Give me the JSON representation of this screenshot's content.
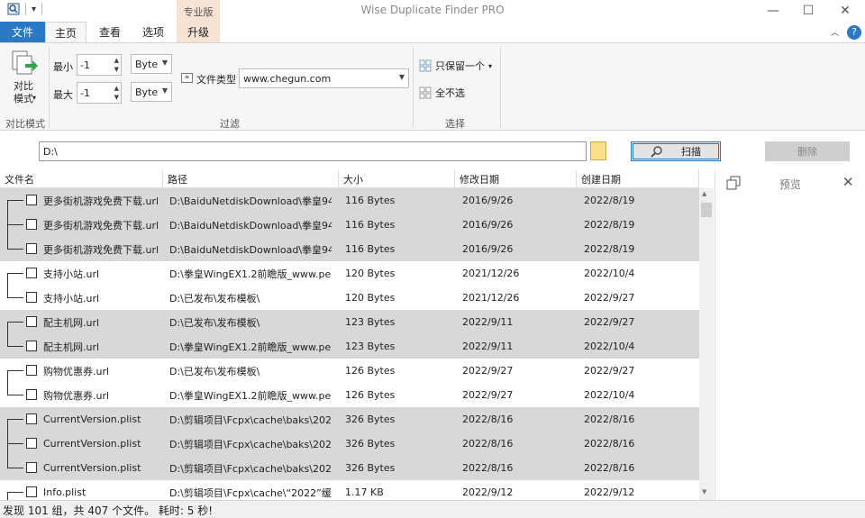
{
  "app": {
    "title": "Wise Duplicate Finder PRO",
    "edition_tab": "专业版"
  },
  "ribbon_tabs": [
    "文件",
    "主页",
    "查看",
    "选项",
    "升级"
  ],
  "compare": {
    "label": "对比\n模式",
    "group_label": "对比模式"
  },
  "filter": {
    "min_label": "最小",
    "max_label": "最大",
    "min_value": "-1",
    "max_value": "-1",
    "min_unit": "Byte",
    "max_unit": "Byte",
    "filetype_label": "文件类型",
    "filetype_value": "www.chegun.com",
    "group_label": "过滤"
  },
  "select": {
    "keep_one": "只保留一个",
    "select_none": "全不选",
    "group_label": "选择"
  },
  "path": {
    "value": "D:\\"
  },
  "scan_label": "扫描",
  "delete_label": "删除",
  "preview_label": "预览",
  "columns": [
    "文件名",
    "路径",
    "大小",
    "修改日期",
    "创建日期"
  ],
  "rows": [
    {
      "name": "更多街机游戏免费下载.url",
      "path": "D:\\BaiduNetdiskDownload\\拳皇94-2...",
      "size": "116 Bytes",
      "modified": "2016/9/26",
      "created": "2022/8/19",
      "shade": true,
      "pos": "first"
    },
    {
      "name": "更多街机游戏免费下载.url",
      "path": "D:\\BaiduNetdiskDownload\\拳皇94-2...",
      "size": "116 Bytes",
      "modified": "2016/9/26",
      "created": "2022/8/19",
      "shade": true,
      "pos": "mid"
    },
    {
      "name": "更多街机游戏免费下载.url",
      "path": "D:\\BaiduNetdiskDownload\\拳皇94-2...",
      "size": "116 Bytes",
      "modified": "2016/9/26",
      "created": "2022/8/19",
      "shade": true,
      "pos": "last"
    },
    {
      "name": "支持小站.url",
      "path": "D:\\拳皇WingEX1.2前瞻版_www.peizh...",
      "size": "120 Bytes",
      "modified": "2021/12/26",
      "created": "2022/10/4",
      "shade": false,
      "pos": "first"
    },
    {
      "name": "支持小站.url",
      "path": "D:\\已发布\\发布模板\\",
      "size": "120 Bytes",
      "modified": "2021/12/26",
      "created": "2022/9/27",
      "shade": false,
      "pos": "last"
    },
    {
      "name": "配主机网.url",
      "path": "D:\\已发布\\发布模板\\",
      "size": "123 Bytes",
      "modified": "2022/9/11",
      "created": "2022/9/27",
      "shade": true,
      "pos": "first"
    },
    {
      "name": "配主机网.url",
      "path": "D:\\拳皇WingEX1.2前瞻版_www.peizh...",
      "size": "123 Bytes",
      "modified": "2022/9/11",
      "created": "2022/10/4",
      "shade": true,
      "pos": "last"
    },
    {
      "name": "购物优惠券.url",
      "path": "D:\\已发布\\发布模板\\",
      "size": "126 Bytes",
      "modified": "2022/9/27",
      "created": "2022/9/27",
      "shade": false,
      "pos": "first"
    },
    {
      "name": "购物优惠券.url",
      "path": "D:\\拳皇WingEX1.2前瞻版_www.peizh...",
      "size": "126 Bytes",
      "modified": "2022/9/27",
      "created": "2022/10/4",
      "shade": false,
      "pos": "last"
    },
    {
      "name": "CurrentVersion.plist",
      "path": "D:\\剪辑项目\\Fcpx\\cache\\baks\\2022\\...",
      "size": "326 Bytes",
      "modified": "2022/8/16",
      "created": "2022/8/16",
      "shade": true,
      "pos": "first"
    },
    {
      "name": "CurrentVersion.plist",
      "path": "D:\\剪辑项目\\Fcpx\\cache\\baks\\2022\\...",
      "size": "326 Bytes",
      "modified": "2022/8/16",
      "created": "2022/8/16",
      "shade": true,
      "pos": "mid"
    },
    {
      "name": "CurrentVersion.plist",
      "path": "D:\\剪辑项目\\Fcpx\\cache\\baks\\2022\\...",
      "size": "326 Bytes",
      "modified": "2022/8/16",
      "created": "2022/8/16",
      "shade": true,
      "pos": "last"
    },
    {
      "name": "Info.plist",
      "path": "D:\\剪辑项目\\Fcpx\\cache\\“2022”缓...",
      "size": "1.17 KB",
      "modified": "2022/9/12",
      "created": "2022/9/12",
      "shade": false,
      "pos": "first"
    }
  ],
  "status": "发现 101 组，共 407 个文件。 耗时: 5 秒!"
}
